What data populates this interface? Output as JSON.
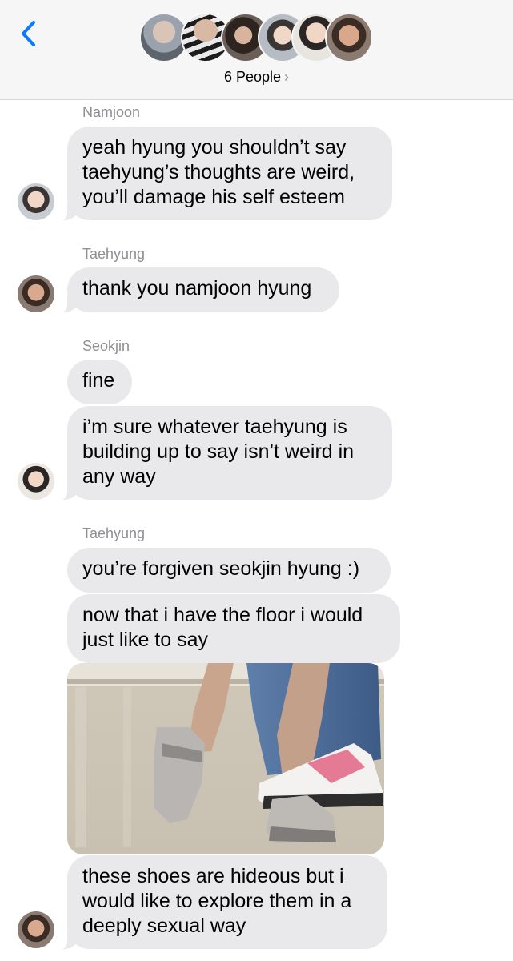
{
  "header": {
    "people_label": "6 People",
    "chevron": "›",
    "avatars": [
      "member-1",
      "member-2",
      "member-3",
      "member-4",
      "member-5",
      "member-6"
    ]
  },
  "messages": [
    {
      "sender": "Namjoon",
      "text": "yeah hyung you shouldn’t say\ntaehyung’s thoughts are weird,\nyou’ll damage his self esteem"
    },
    {
      "sender": "Taehyung",
      "text": "thank you namjoon hyung"
    },
    {
      "sender": "Seokjin",
      "text": "fine"
    },
    {
      "text": "i’m sure whatever taehyung is\nbuilding up to say isn’t weird in\nany way"
    },
    {
      "sender": "Taehyung",
      "text": "you’re forgiven seokjin hyung :)"
    },
    {
      "text": "now that i have the floor i would\njust like to say"
    },
    {
      "text": "these shoes are hideous but i\nwould like to explore them in a\ndeeply sexual way"
    }
  ],
  "colors": {
    "accent": "#0a7aff",
    "bubble": "#e9e9eb",
    "sender_name": "#8e8e93",
    "header_bg": "#f6f6f6"
  }
}
